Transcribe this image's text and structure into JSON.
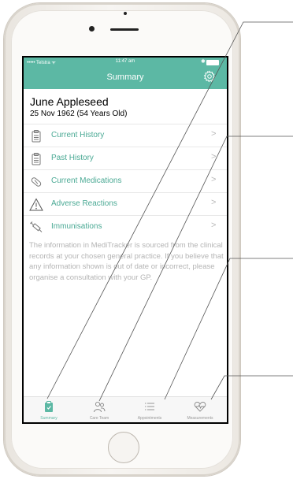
{
  "status_bar": {
    "carrier": "••••• Telstra ᯤ",
    "time": "11:47 am",
    "bluetooth": "✱"
  },
  "header": {
    "title": "Summary"
  },
  "patient": {
    "name": "June Appleseed",
    "dob": "25 Nov 1962 (54 Years Old)"
  },
  "menu": [
    {
      "label": "Current History",
      "icon": "clipboard-icon"
    },
    {
      "label": "Past History",
      "icon": "clipboard-icon"
    },
    {
      "label": "Current Medications",
      "icon": "pill-icon"
    },
    {
      "label": "Adverse Reactions",
      "icon": "warning-icon"
    },
    {
      "label": "Immunisations",
      "icon": "syringe-icon"
    }
  ],
  "chevron": ">",
  "info_text": "The information in MediTracker is sourced from the clinical records at your chosen general practice. If you believe that any information shown is out of date or incorrect, please organise a consultation with your GP.",
  "tabs": [
    {
      "label": "Summary",
      "icon": "summary-icon",
      "active": true
    },
    {
      "label": "Care Team",
      "icon": "care-team-icon",
      "active": false
    },
    {
      "label": "Appointments",
      "icon": "appointments-icon",
      "active": false
    },
    {
      "label": "Measurements",
      "icon": "heart-icon",
      "active": false
    }
  ],
  "colors": {
    "accent": "#5cb8a4",
    "link_text": "#4aa994",
    "info_text": "#b4b4b4"
  }
}
